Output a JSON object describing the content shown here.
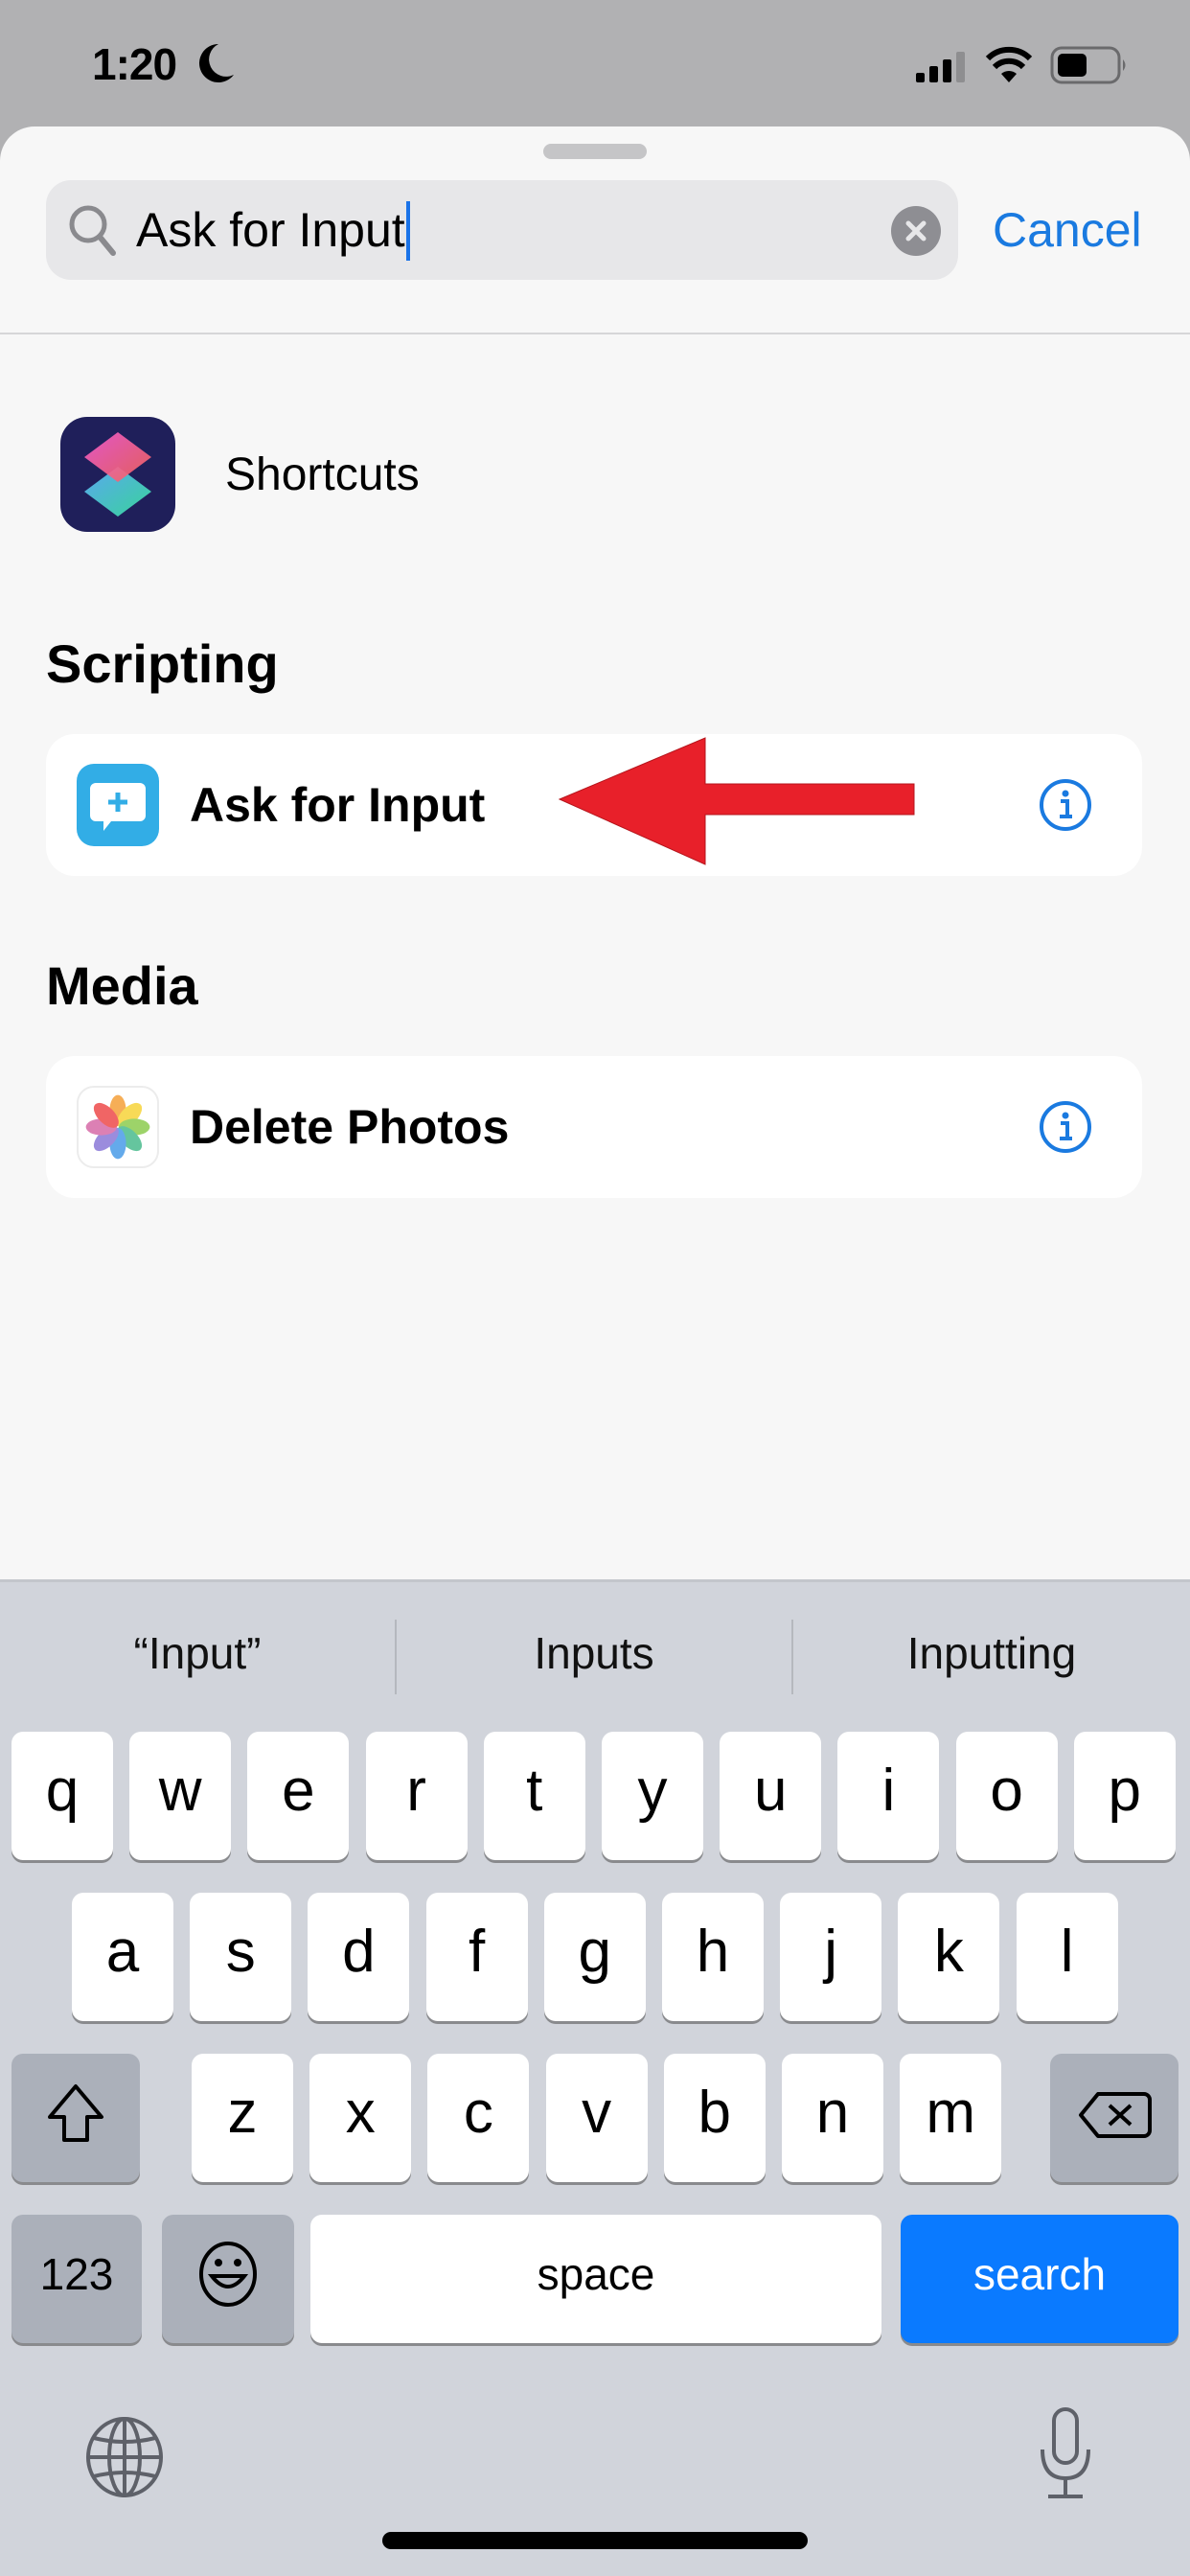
{
  "status_bar": {
    "time": "1:20",
    "focus_icon": "moon-icon",
    "signal_icon": "cellular-signal-icon",
    "wifi_icon": "wifi-icon",
    "battery_icon": "battery-icon"
  },
  "search": {
    "value": "Ask for Input",
    "icon": "search-icon",
    "clear_icon": "clear-icon",
    "cancel_label": "Cancel"
  },
  "app_result": {
    "label": "Shortcuts",
    "icon": "shortcuts-app-icon"
  },
  "sections": [
    {
      "title": "Scripting",
      "actions": [
        {
          "label": "Ask for Input",
          "icon": "ask-for-input-icon",
          "info_icon": "info-icon"
        }
      ]
    },
    {
      "title": "Media",
      "actions": [
        {
          "label": "Delete Photos",
          "icon": "photos-app-icon",
          "info_icon": "info-icon"
        }
      ]
    }
  ],
  "annotation": {
    "icon": "red-arrow-pointing-left",
    "color": "#e8202a"
  },
  "keyboard": {
    "suggestions": [
      "“Input”",
      "Inputs",
      "Inputting"
    ],
    "row1": [
      "q",
      "w",
      "e",
      "r",
      "t",
      "y",
      "u",
      "i",
      "o",
      "p"
    ],
    "row2": [
      "a",
      "s",
      "d",
      "f",
      "g",
      "h",
      "j",
      "k",
      "l"
    ],
    "row3": [
      "z",
      "x",
      "c",
      "v",
      "b",
      "n",
      "m"
    ],
    "numbers_label": "123",
    "space_label": "space",
    "return_label": "search",
    "shift_icon": "shift-icon",
    "delete_icon": "delete-icon",
    "emoji_icon": "emoji-icon",
    "globe_icon": "globe-icon",
    "mic_icon": "microphone-icon",
    "accent_color": "#0a7aff"
  }
}
